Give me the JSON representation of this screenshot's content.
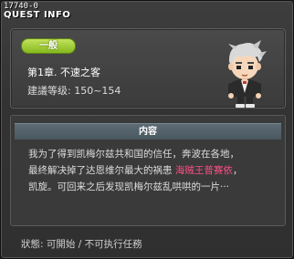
{
  "window": {
    "id_label": "17740-0",
    "title": "QUEST INFO"
  },
  "quest": {
    "category_badge": "一般",
    "title": "第1章. 不速之客",
    "level_requirement": "建議等级: 150~154"
  },
  "content": {
    "header": "内容",
    "text_line1": "我为了得到凯梅尔兹共和国的信任，奔波在各地，",
    "text_line2_before": "最终解决掉了达恩维尔最大的祸患 ",
    "text_line2_highlight": "海贼王普赛依",
    "text_line2_after": "，",
    "text_line3": "凯旋。可回来之后发现凯梅尔兹乱哄哄的一片···",
    "highlight_color": "#ff4f86"
  },
  "status": {
    "text": "狀態: 可開始 / 不可执行任務"
  }
}
